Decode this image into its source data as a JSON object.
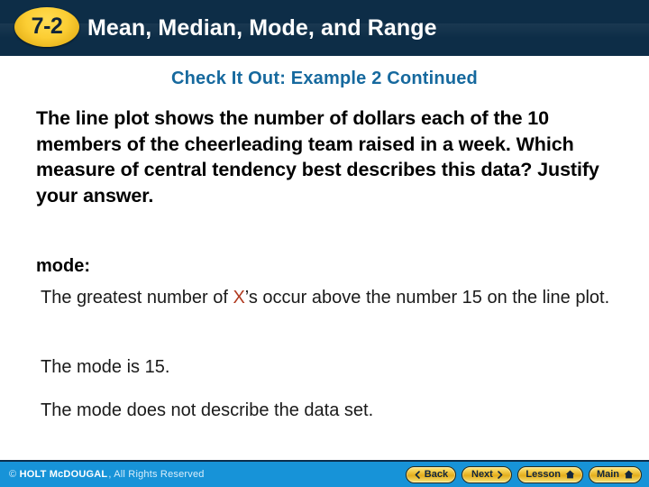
{
  "header": {
    "badge": "7-2",
    "title": "Mean, Median, Mode, and Range",
    "badge_color": "#f6ce34",
    "bar_color": "#0d2d47"
  },
  "main": {
    "subtitle": "Check It Out: Example 2 Continued",
    "subtitle_color": "#16699e",
    "problem": "The line plot shows the number of dollars each of the 10 members of the cheerleading team raised in a week. Which measure of central tendency best describes this data? Justify your answer.",
    "answer_label": "mode:",
    "explanation_before_x": "The greatest number of ",
    "explanation_x": "X",
    "explanation_after_x": "’s occur above the number 15 on the line plot.",
    "x_color": "#b03a20",
    "conclusion": "The mode is 15.",
    "evaluation": "The mode does not describe the data set."
  },
  "footer": {
    "copyright_symbol": "©",
    "brand": "HOLT McDOUGAL",
    "rights": ", All Rights Reserved",
    "bar_color": "#1793d8",
    "buttons": [
      {
        "label": "Back",
        "icon": "chevron-left-icon"
      },
      {
        "label": "Next",
        "icon": "chevron-right-icon"
      },
      {
        "label": "Lesson",
        "icon": "home-icon"
      },
      {
        "label": "Main",
        "icon": "home-icon"
      }
    ]
  }
}
